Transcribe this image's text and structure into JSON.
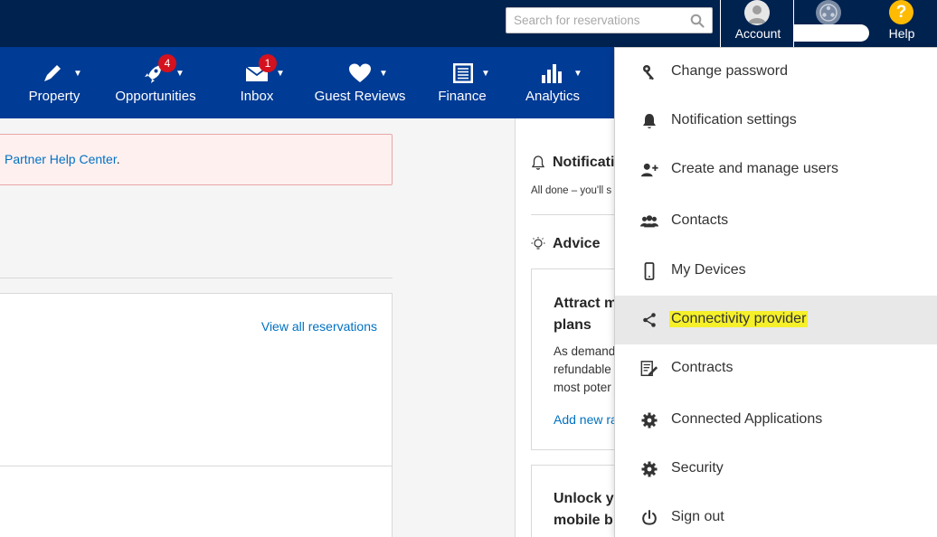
{
  "search": {
    "placeholder": "Search for reservations",
    "icon": "search-icon"
  },
  "header": {
    "account_label": "Account",
    "help_label": "Help",
    "help_glyph": "?"
  },
  "nav": {
    "items": [
      {
        "label": "Property",
        "icon": "pencil-icon",
        "badge": ""
      },
      {
        "label": "Opportunities",
        "icon": "rocket-icon",
        "badge": "4"
      },
      {
        "label": "Inbox",
        "icon": "envelope-icon",
        "badge": "1"
      },
      {
        "label": "Guest Reviews",
        "icon": "heart-icon",
        "badge": ""
      },
      {
        "label": "Finance",
        "icon": "ledger-icon",
        "badge": ""
      },
      {
        "label": "Analytics",
        "icon": "bar-chart-icon",
        "badge": ""
      }
    ],
    "caret": "▼"
  },
  "main": {
    "alert_link": "Partner Help Center",
    "alert_after": ".",
    "view_all": "View all reservations"
  },
  "sidebar": {
    "notifications_title": "Notificati",
    "notifications_text": "All done – you'll s",
    "advice_title": "Advice",
    "card1": {
      "title_line1": "Attract m",
      "title_line2": "plans",
      "line1": "As demand",
      "line2": "refundable",
      "line3": "most poter",
      "link": "Add new ra"
    },
    "card2": {
      "title_line1": "Unlock yo",
      "title_line2": "mobile b"
    }
  },
  "account_menu": {
    "items": [
      {
        "label": "Change password",
        "icon": "key-icon"
      },
      {
        "label": "Notification settings",
        "icon": "bell-icon"
      },
      {
        "label": "Create and manage users",
        "icon": "add-user-icon"
      },
      {
        "label": "Contacts",
        "icon": "contacts-icon"
      },
      {
        "label": "My Devices",
        "icon": "phone-icon"
      },
      {
        "label": "Connectivity provider",
        "icon": "share-icon",
        "highlighted": true
      },
      {
        "label": "Contracts",
        "icon": "contract-icon"
      },
      {
        "label": "Connected Applications",
        "icon": "gear-icon"
      },
      {
        "label": "Security",
        "icon": "gear-icon"
      },
      {
        "label": "Sign out",
        "icon": "power-icon"
      }
    ]
  },
  "colors": {
    "top_bar": "#00224f",
    "nav_bar": "#003b95",
    "link": "#0071c2",
    "badge": "#d4111e",
    "help": "#febb02",
    "highlight": "#f5f02a"
  }
}
